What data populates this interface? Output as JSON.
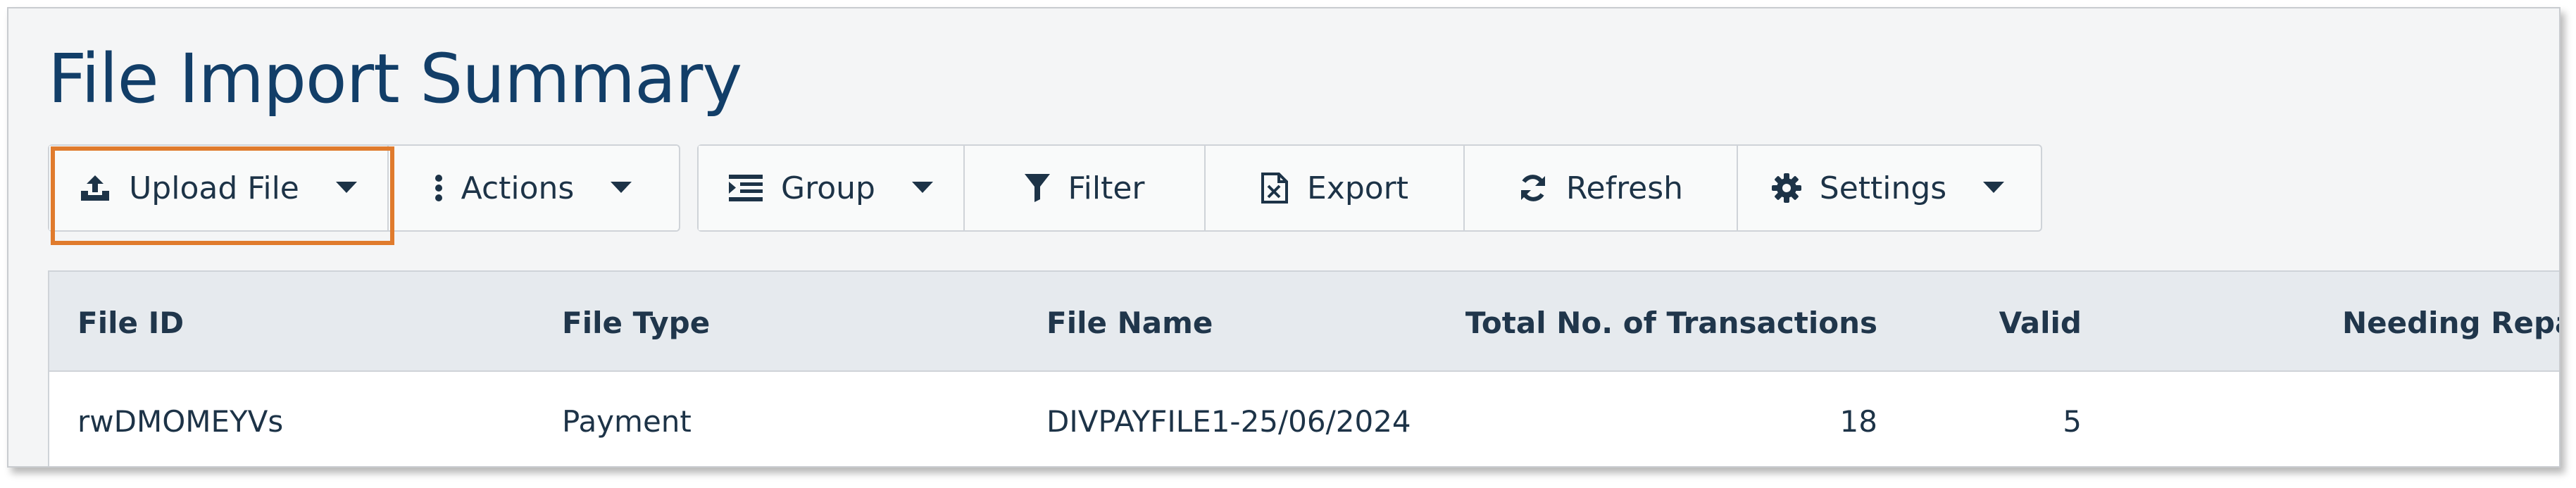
{
  "page": {
    "title": "File Import Summary"
  },
  "toolbar": {
    "upload_label": "Upload File",
    "actions_label": "Actions",
    "group_label": "Group",
    "filter_label": "Filter",
    "export_label": "Export",
    "refresh_label": "Refresh",
    "settings_label": "Settings"
  },
  "table": {
    "headers": {
      "file_id": "File ID",
      "file_type": "File Type",
      "file_name": "File Name",
      "total": "Total No. of Transactions",
      "valid": "Valid",
      "needing_repair": "Needing Repa"
    },
    "rows": [
      {
        "file_id": "rwDMOMEYVs",
        "file_type": "Payment",
        "file_name": "DIVPAYFILE1-25/06/2024",
        "total": "18",
        "valid": "5",
        "needing_repair": ""
      }
    ]
  },
  "colors": {
    "title": "#123e68",
    "highlight": "#e07b2d",
    "header_bg": "#e6eaee"
  },
  "icons": [
    "upload-icon",
    "more-vertical-icon",
    "group-icon",
    "filter-icon",
    "export-excel-icon",
    "refresh-icon",
    "gear-icon",
    "caret-down-icon"
  ]
}
